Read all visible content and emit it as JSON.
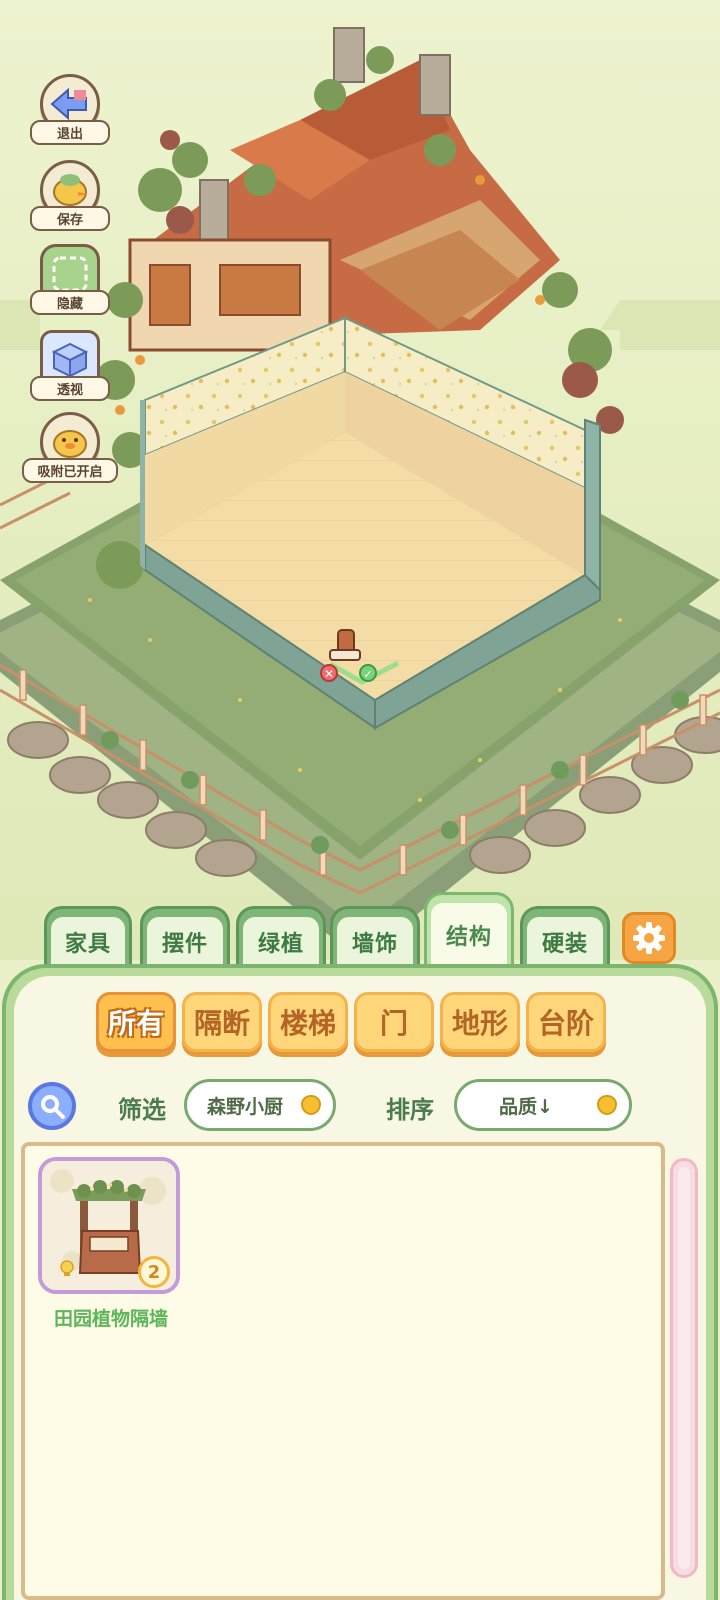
{
  "left_tools": [
    {
      "key": "exit",
      "label": "退出",
      "icon": "exit-arrow-icon"
    },
    {
      "key": "save",
      "label": "保存",
      "icon": "duck-save-icon"
    },
    {
      "key": "hide",
      "label": "隐藏",
      "icon": "hide-icon"
    },
    {
      "key": "perspective",
      "label": "透视",
      "icon": "cube-perspective-icon"
    },
    {
      "key": "snap",
      "label": "吸附已开启",
      "icon": "duck-magnet-icon"
    }
  ],
  "category_tabs": [
    {
      "label": "家具",
      "active": false
    },
    {
      "label": "摆件",
      "active": false
    },
    {
      "label": "绿植",
      "active": false
    },
    {
      "label": "墙饰",
      "active": false
    },
    {
      "label": "结构",
      "active": true
    },
    {
      "label": "硬装",
      "active": false
    }
  ],
  "settings_icon": "gear-icon",
  "sub_tabs": [
    {
      "label": "所有",
      "active": true
    },
    {
      "label": "隔断",
      "active": false
    },
    {
      "label": "楼梯",
      "active": false
    },
    {
      "label": "门",
      "active": false
    },
    {
      "label": "地形",
      "active": false
    },
    {
      "label": "台阶",
      "active": false
    }
  ],
  "filter": {
    "label": "筛选",
    "value": "森野小厨"
  },
  "sort": {
    "label": "排序",
    "value": "品质↓"
  },
  "items": [
    {
      "name": "田园植物隔墙",
      "count": "2",
      "rarity_color": "#c59ad8"
    }
  ],
  "colors": {
    "accent_green": "#7db46e",
    "accent_orange": "#f7a542",
    "tab_text": "#3f7a42"
  }
}
